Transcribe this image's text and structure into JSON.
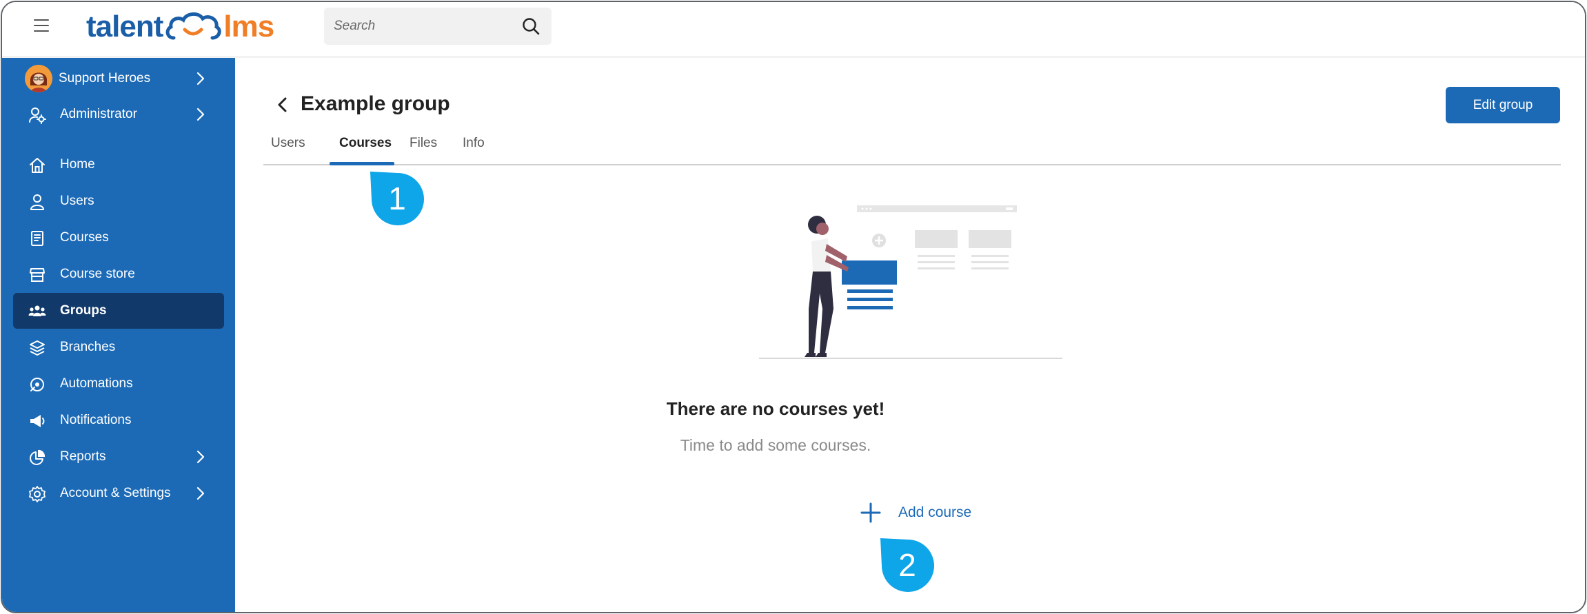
{
  "topbar": {
    "logo_left": "talent",
    "logo_right": "lms",
    "search_placeholder": "Search"
  },
  "sidebar": {
    "account": {
      "label": "Support Heroes"
    },
    "role": {
      "label": "Administrator"
    },
    "items": [
      {
        "label": "Home",
        "icon": "home-icon"
      },
      {
        "label": "Users",
        "icon": "user-icon"
      },
      {
        "label": "Courses",
        "icon": "book-icon"
      },
      {
        "label": "Course store",
        "icon": "store-icon"
      },
      {
        "label": "Groups",
        "icon": "groups-icon",
        "active": true
      },
      {
        "label": "Branches",
        "icon": "layers-icon"
      },
      {
        "label": "Automations",
        "icon": "automation-icon"
      },
      {
        "label": "Notifications",
        "icon": "megaphone-icon"
      },
      {
        "label": "Reports",
        "icon": "pie-chart-icon"
      },
      {
        "label": "Account & Settings",
        "icon": "gear-icon"
      }
    ]
  },
  "main": {
    "title": "Example group",
    "edit_button": "Edit group",
    "tabs": [
      {
        "label": "Users"
      },
      {
        "label": "Courses",
        "active": true
      },
      {
        "label": "Files"
      },
      {
        "label": "Info"
      }
    ],
    "empty_state": {
      "heading": "There are no courses yet!",
      "subtext": "Time to add some courses.",
      "add_label": "Add course"
    }
  },
  "callouts": [
    {
      "number": "1"
    },
    {
      "number": "2"
    }
  ],
  "colors": {
    "brand_blue": "#1c6ab6",
    "sidebar_active": "#11396a",
    "logo_orange": "#f07e26",
    "callout_blue": "#0ea5e9"
  }
}
